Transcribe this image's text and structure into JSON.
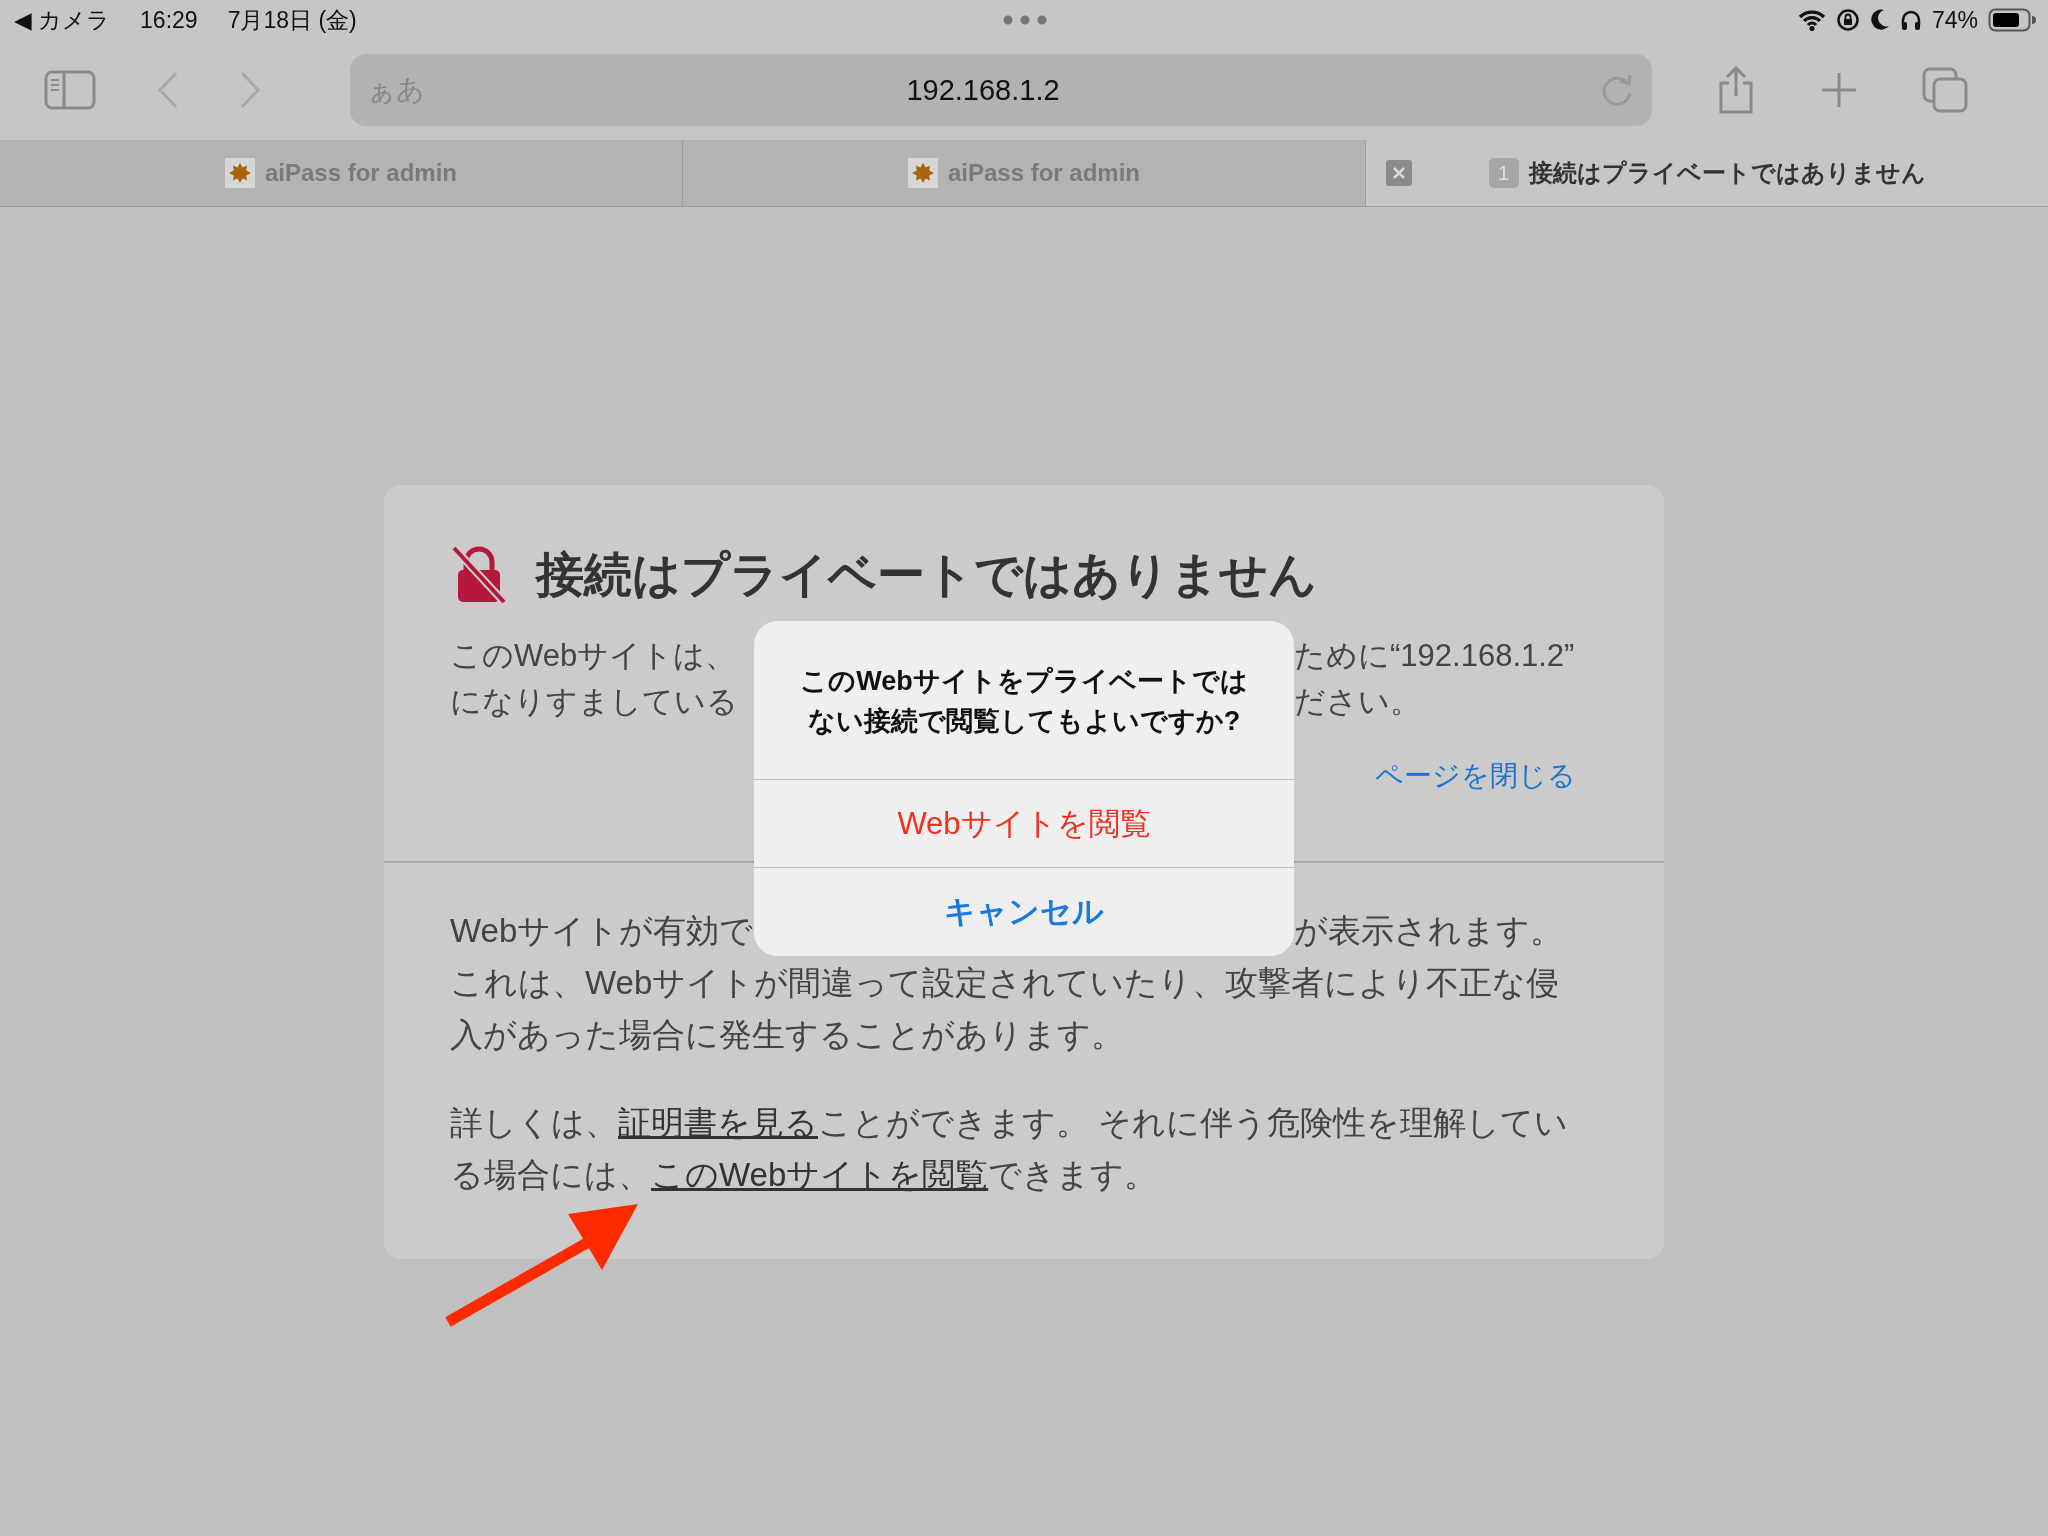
{
  "status_bar": {
    "back_app": "◀ カメラ",
    "time": "16:29",
    "date": "7月18日 (金)",
    "battery": "74%"
  },
  "toolbar": {
    "text_size": "ぁあ",
    "url": "192.168.1.2"
  },
  "tabs": [
    {
      "title": "aiPass for admin",
      "selected": false,
      "kind": "site"
    },
    {
      "title": "aiPass for admin",
      "selected": false,
      "kind": "site"
    },
    {
      "title": "接続はプライベートではありません",
      "selected": true,
      "kind": "warning",
      "badge": "1"
    }
  ],
  "warning_page": {
    "title": "接続はプライベートではありません",
    "intro_lines": [
      [
        "このWebサイトは、",
        "ために“192.168.1.2”"
      ],
      [
        "になりすましている",
        "ださい。"
      ]
    ],
    "close_link": "ページを閉じる",
    "detail_lines": [
      [
        "Webサイトが有効で",
        "が表示されます。"
      ],
      [
        "これは、Webサイトが間違って設定されていたり、攻撃者により不正な侵"
      ],
      [
        "入があった場合に発生することがあります。"
      ]
    ],
    "more_lines": [
      [
        {
          "kind": "text",
          "text": "詳しくは、"
        },
        {
          "kind": "link",
          "text": "証明書を見る"
        },
        {
          "kind": "text",
          "text": "ことができます。 それに伴う危険性を理解してい"
        }
      ],
      [
        {
          "kind": "text",
          "text": "る場合には、"
        },
        {
          "kind": "link",
          "text": "このWebサイトを閲覧"
        },
        {
          "kind": "text",
          "text": "できます。"
        }
      ]
    ]
  },
  "alert": {
    "message_lines": [
      "このWebサイトをプライベートでは",
      "ない接続で閲覧してもよいですか?"
    ],
    "buttons": [
      {
        "label": "Webサイトを閲覧",
        "kind": "destructive"
      },
      {
        "label": "キャンセル",
        "kind": "cancel"
      }
    ]
  }
}
